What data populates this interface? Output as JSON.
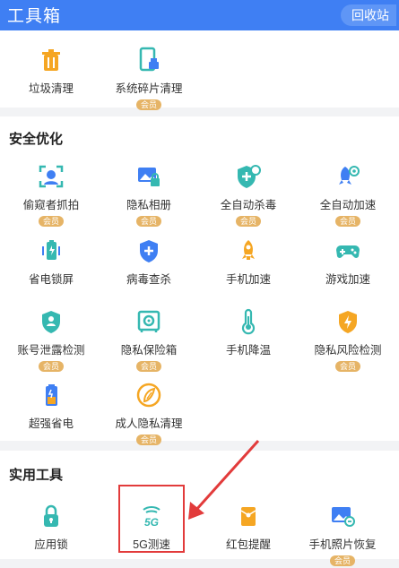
{
  "header": {
    "title": "工具箱",
    "recycle_button": "回收站"
  },
  "vip_badge": "会员",
  "top_tools": [
    {
      "label": "垃圾清理",
      "icon": "trash-icon",
      "vip": false
    },
    {
      "label": "系统碎片清理",
      "icon": "phone-clean-icon",
      "vip": true
    }
  ],
  "security": {
    "title": "安全优化",
    "tools": [
      {
        "label": "偷窥者抓拍",
        "icon": "face-scan-icon",
        "vip": true
      },
      {
        "label": "隐私相册",
        "icon": "photo-lock-icon",
        "vip": true
      },
      {
        "label": "全自动杀毒",
        "icon": "shield-plus-icon",
        "vip": true
      },
      {
        "label": "全自动加速",
        "icon": "rocket-gear-icon",
        "vip": true
      },
      {
        "label": "省电锁屏",
        "icon": "battery-icon",
        "vip": false
      },
      {
        "label": "病毒查杀",
        "icon": "shield-cross-icon",
        "vip": false
      },
      {
        "label": "手机加速",
        "icon": "rocket-icon",
        "vip": false
      },
      {
        "label": "游戏加速",
        "icon": "gamepad-icon",
        "vip": false
      },
      {
        "label": "账号泄露检测",
        "icon": "user-shield-icon",
        "vip": true
      },
      {
        "label": "隐私保险箱",
        "icon": "safe-icon",
        "vip": true
      },
      {
        "label": "手机降温",
        "icon": "thermometer-icon",
        "vip": false
      },
      {
        "label": "隐私风险检测",
        "icon": "shield-bolt-icon",
        "vip": true
      },
      {
        "label": "超强省电",
        "icon": "battery-bolt-icon",
        "vip": false
      },
      {
        "label": "成人隐私清理",
        "icon": "leaf-circle-icon",
        "vip": true
      }
    ]
  },
  "utilities": {
    "title": "实用工具",
    "tools": [
      {
        "label": "应用锁",
        "icon": "lock-icon",
        "vip": false
      },
      {
        "label": "5G测速",
        "icon": "5g-icon",
        "vip": false,
        "icon_text": "5G"
      },
      {
        "label": "红包提醒",
        "icon": "red-envelope-icon",
        "vip": false
      },
      {
        "label": "手机照片恢复",
        "icon": "photo-restore-icon",
        "vip": true
      }
    ]
  },
  "colors": {
    "header": "#3f7ff3",
    "teal": "#35b8b1",
    "blue": "#3f7ff3",
    "orange": "#f5a623",
    "vip": "#e6b466",
    "highlight": "#e23b3b"
  }
}
